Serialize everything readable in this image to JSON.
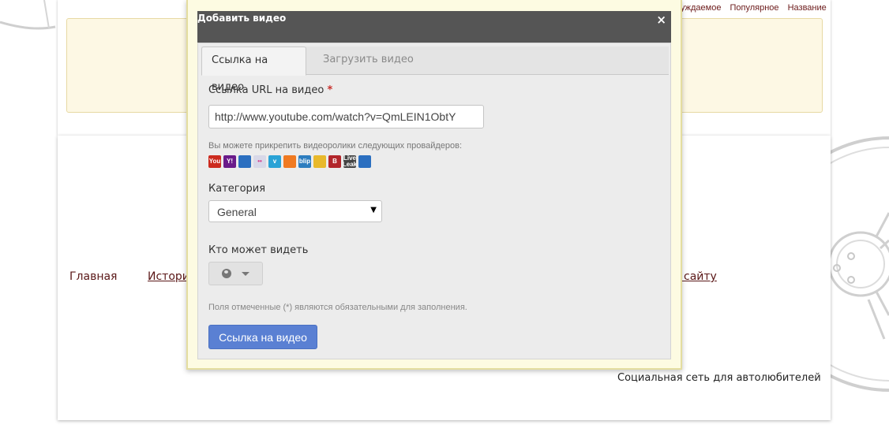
{
  "page": {
    "sort_links": [
      "уждаемое",
      "Популярное",
      "Название"
    ],
    "nav": {
      "home": "Главная",
      "history_partial": "Истори",
      "about_partial": "о сайту"
    },
    "footer_text": "Социальная сеть для автолюбителей"
  },
  "modal": {
    "title": "Добавить видео",
    "close_glyph": "×",
    "tabs": [
      {
        "label": "Ссылка на видео",
        "active": true
      },
      {
        "label": "Загрузить видео",
        "active": false
      }
    ],
    "url_field": {
      "label": "Ссылка URL на видео",
      "required_mark": "*",
      "value": "http://www.youtube.com/watch?v=QmLEIN1ObtY"
    },
    "providers_text": "Вы можете прикрепить видеоролики следующих провайдеров:",
    "providers": [
      {
        "name": "youtube-icon",
        "text": "You",
        "color": "#cc2b1f"
      },
      {
        "name": "yahoo-icon",
        "text": "Y!",
        "color": "#6a1b8a"
      },
      {
        "name": "msn-icon",
        "text": "",
        "color": "#2b6fc0"
      },
      {
        "name": "flickr-icon",
        "text": "••",
        "color": "#d8d8e8"
      },
      {
        "name": "vimeo-icon",
        "text": "v",
        "color": "#2aa3d6"
      },
      {
        "name": "myspace-icon",
        "text": "",
        "color": "#f07a22"
      },
      {
        "name": "blip-icon",
        "text": "blip",
        "color": "#2d7dbf"
      },
      {
        "name": "warning-icon",
        "text": "",
        "color": "#e8b92c"
      },
      {
        "name": "vk-icon",
        "text": "B",
        "color": "#b2262b"
      },
      {
        "name": "liveleak-icon",
        "text": "Live Leak",
        "color": "#444444"
      },
      {
        "name": "dailymotion-icon",
        "text": "",
        "color": "#2b6fc0"
      }
    ],
    "category": {
      "label": "Категория",
      "value": "General"
    },
    "privacy": {
      "label": "Кто может видеть"
    },
    "required_note": "Поля отмеченные (*) являются обязательными для заполнения.",
    "submit_label": "Ссылка на видео"
  }
}
